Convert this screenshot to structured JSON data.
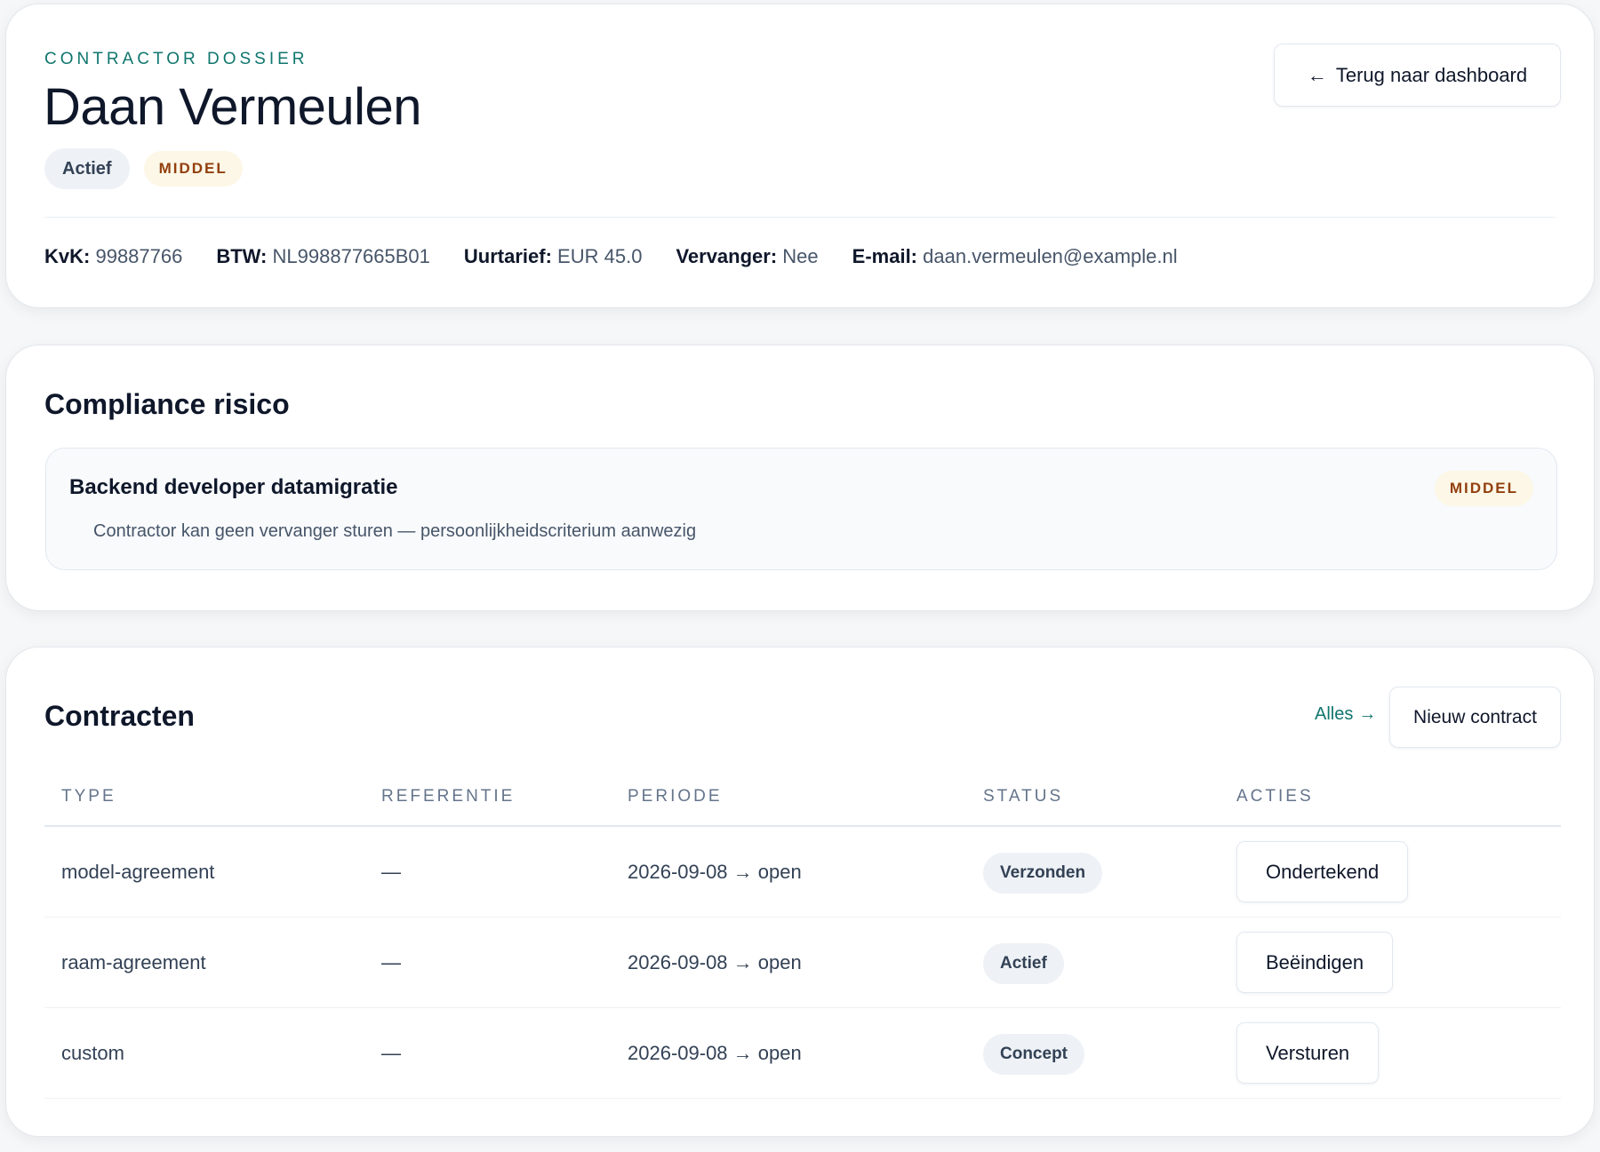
{
  "header": {
    "eyebrow": "CONTRACTOR DOSSIER",
    "name": "Daan Vermeulen",
    "status_badge": "Actief",
    "risk_badge": "MIDDEL",
    "back_button": "Terug naar dashboard",
    "back_icon": "←",
    "facts": [
      {
        "label": "KvK:",
        "value": "99887766"
      },
      {
        "label": "BTW:",
        "value": "NL998877665B01"
      },
      {
        "label": "Uurtarief:",
        "value": "EUR 45.0"
      },
      {
        "label": "Vervanger:",
        "value": "Nee"
      },
      {
        "label": "E-mail:",
        "value": "daan.vermeulen@example.nl"
      }
    ]
  },
  "compliance": {
    "title": "Compliance risico",
    "item": {
      "title": "Backend developer datamigratie",
      "description": "Contractor kan geen vervanger sturen — persoonlijkheidscriterium aanwezig",
      "risk": "MIDDEL"
    }
  },
  "contracts": {
    "title": "Contracten",
    "all_link": "Alles",
    "all_icon": "→",
    "new_button": "Nieuw contract",
    "columns": [
      "TYPE",
      "REFERENTIE",
      "PERIODE",
      "STATUS",
      "ACTIES"
    ],
    "rows": [
      {
        "type": "model-agreement",
        "reference": "—",
        "period": "2026-09-08 → open",
        "status": "Verzonden",
        "action": "Ondertekend"
      },
      {
        "type": "raam-agreement",
        "reference": "—",
        "period": "2026-09-08 → open",
        "status": "Actief",
        "action": "Beëindigen"
      },
      {
        "type": "custom",
        "reference": "—",
        "period": "2026-09-08 → open",
        "status": "Concept",
        "action": "Versturen"
      }
    ]
  },
  "colors": {
    "accent": "#0f766e",
    "risk_medium_bg": "#fdf7e7",
    "risk_medium_text": "#92400e",
    "pill_bg": "#eef2f6"
  }
}
